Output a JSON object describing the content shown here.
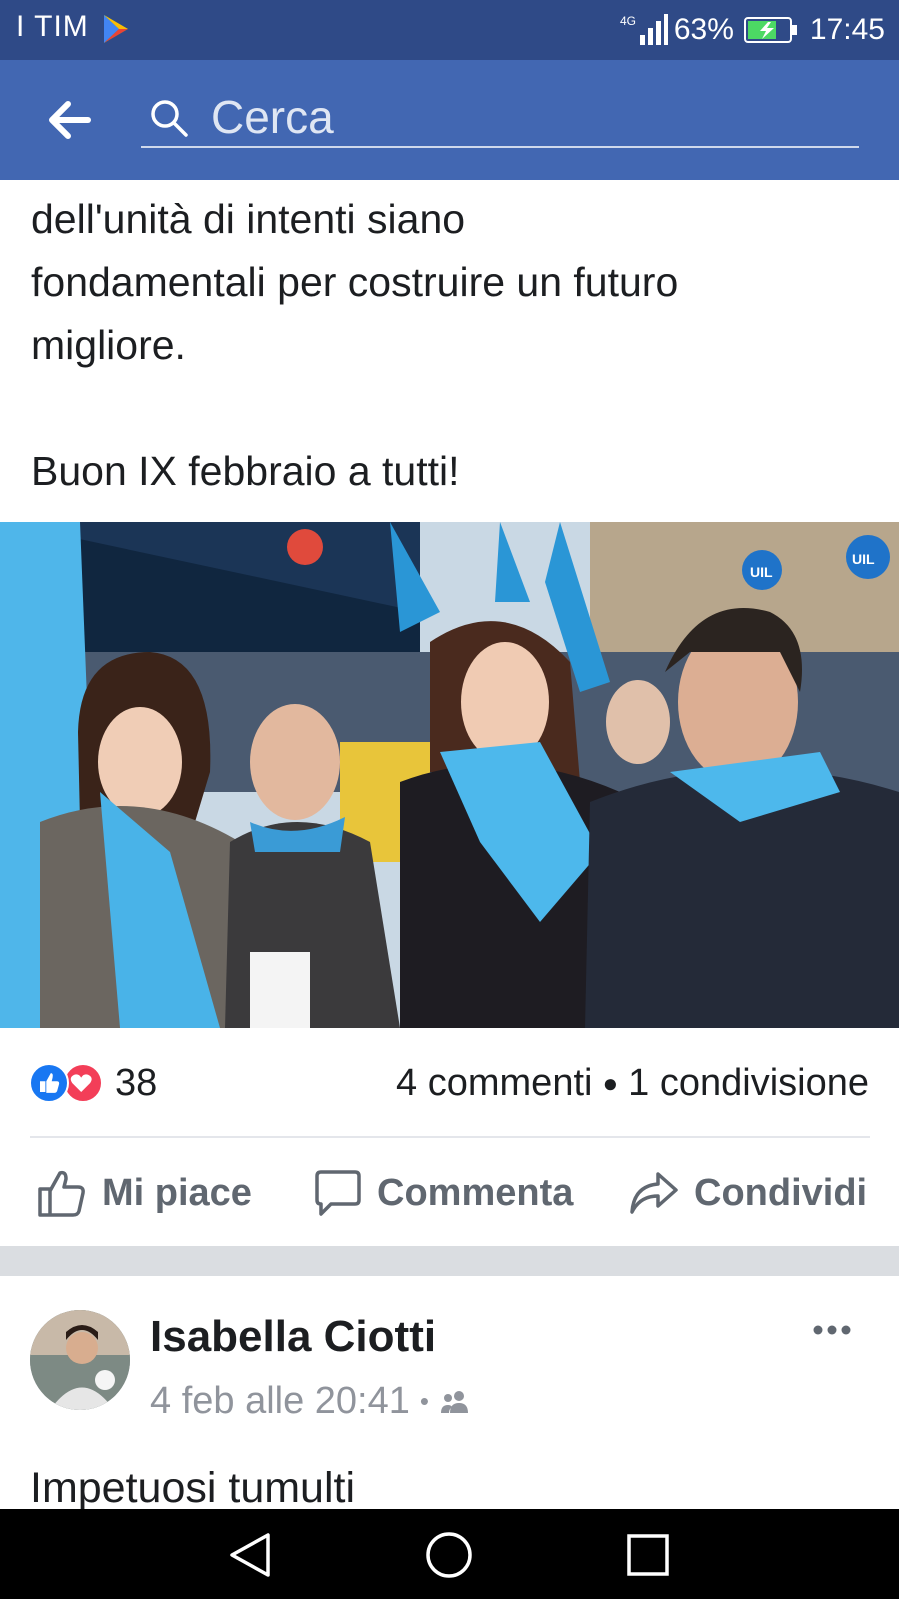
{
  "status_bar": {
    "carrier": "I TIM",
    "network": "4G",
    "battery": "63%",
    "time": "17:45"
  },
  "search": {
    "placeholder": "Cerca"
  },
  "post": {
    "text_lines": [
      "dell'unità di intenti siano",
      "fondamentali per costruire un futuro",
      "migliore."
    ],
    "closing": "Buon IX febbraio a tutti!",
    "photo_sign_text": "UIL",
    "reactions_count": "38",
    "comments": "4 commenti",
    "shares": "1 condivisione",
    "actions": {
      "like": "Mi piace",
      "comment": "Commenta",
      "share": "Condividi"
    }
  },
  "next_post": {
    "author": "Isabella Ciotti",
    "timestamp": "4 feb alle 20:41",
    "text_preview": "Impetuosi tumulti"
  },
  "colors": {
    "status_bar": "#2f4a87",
    "header": "#4267b2",
    "like_blue": "#1877f2",
    "love_red": "#f33e58"
  },
  "icons": {
    "back": "arrow-left-icon",
    "search": "magnifier-icon",
    "like": "thumbs-up-icon",
    "comment": "speech-bubble-icon",
    "share": "share-arrow-icon",
    "audience": "friends-icon",
    "more": "more-dots-icon"
  }
}
